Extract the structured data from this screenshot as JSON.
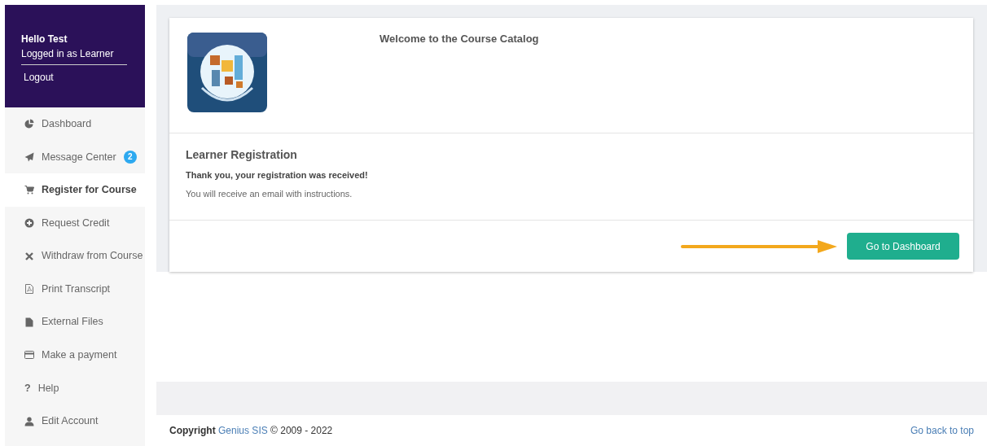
{
  "user": {
    "greeting": "Hello Test",
    "role_line": "Logged in as Learner",
    "logout": "Logout"
  },
  "sidebar": {
    "items": [
      {
        "label": "Dashboard",
        "selected": false
      },
      {
        "label": "Message Center",
        "selected": false,
        "badge": "2"
      },
      {
        "label": "Register for Course",
        "selected": true
      },
      {
        "label": "Request Credit",
        "selected": false
      },
      {
        "label": "Withdraw from Course",
        "selected": false
      },
      {
        "label": "Print Transcript",
        "selected": false
      },
      {
        "label": "External Files",
        "selected": false
      },
      {
        "label": "Make a payment",
        "selected": false
      },
      {
        "label": "Help",
        "glyph": "?",
        "selected": false
      },
      {
        "label": "Edit Account",
        "selected": false
      }
    ]
  },
  "card": {
    "title": "Welcome to the Course Catalog",
    "heading": "Learner Registration",
    "confirmation": "Thank you, your registration was received!",
    "note": "You will receive an email with instructions.",
    "button": "Go to Dashboard"
  },
  "footer": {
    "copyright_label": "Copyright",
    "company_link": "Genius SIS",
    "years": "© 2009 - 2022",
    "top_link": "Go back to top"
  }
}
